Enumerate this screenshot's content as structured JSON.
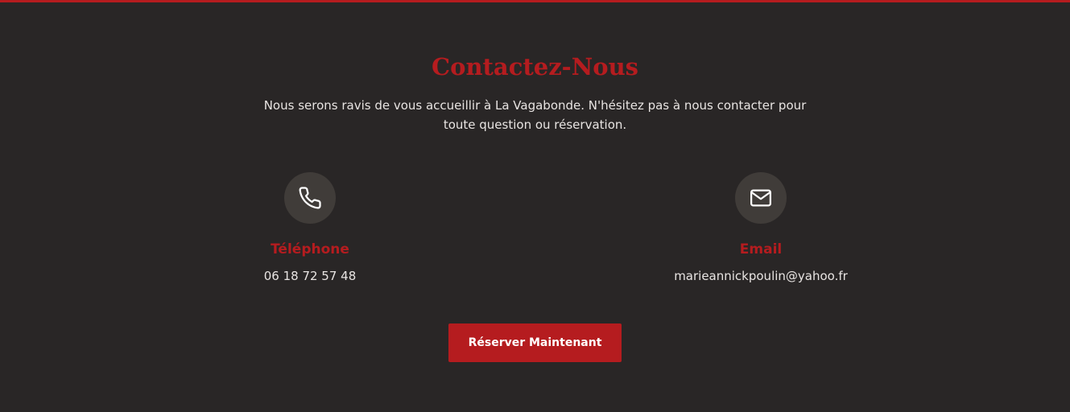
{
  "colors": {
    "background": "#292626",
    "accent": "#b51c1f",
    "icon_circle": "#403c39",
    "text": "#e8e4e2"
  },
  "contact": {
    "title": "Contactez-Nous",
    "description": "Nous serons ravis de vous accueillir à La Vagabonde. N'hésitez pas à nous contacter pour toute question ou réservation.",
    "phone": {
      "icon": "phone-icon",
      "label": "Téléphone",
      "value": "06 18 72 57 48"
    },
    "email": {
      "icon": "mail-icon",
      "label": "Email",
      "value": "marieannickpoulin@yahoo.fr"
    },
    "cta_label": "Réserver Maintenant"
  }
}
